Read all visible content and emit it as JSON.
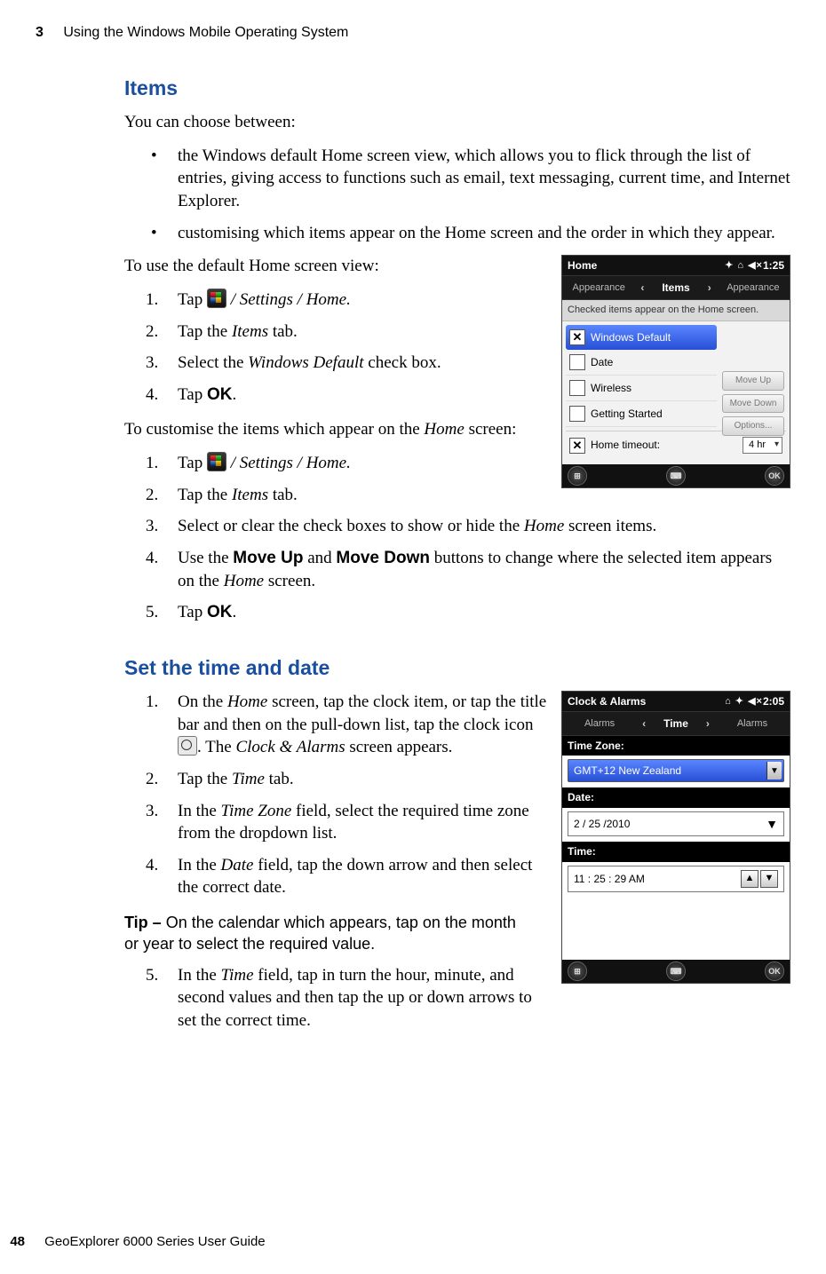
{
  "header": {
    "chapter_number": "3",
    "chapter_title": "Using the Windows Mobile Operating System"
  },
  "section_items": {
    "heading": "Items",
    "intro": "You can choose between:",
    "bullets": [
      "the Windows default Home screen view, which allows you to flick through the list of entries,  giving access to functions such as email, text messaging, current time, and Internet Explorer.",
      "customising which items appear on the Home screen and the order in which they appear."
    ],
    "para_default": "To use the default Home screen view:",
    "steps_default": {
      "s1_pre": "Tap ",
      "s1_post": " / Settings / Home.",
      "s2_pre": "Tap the ",
      "s2_italic": "Items",
      "s2_post": " tab.",
      "s3_pre": "Select the ",
      "s3_italic": "Windows Default",
      "s3_post": " check box.",
      "s4_pre": "Tap ",
      "s4_bold": "OK",
      "s4_post": "."
    },
    "para_custom_pre": "To customise the items which appear on the ",
    "para_custom_italic": "Home",
    "para_custom_post": " screen:",
    "steps_custom": {
      "s1_pre": "Tap ",
      "s1_post": " / Settings / Home.",
      "s2_pre": "Tap the ",
      "s2_italic": "Items",
      "s2_post": " tab.",
      "s3_pre": "Select or clear the check boxes to show or hide the ",
      "s3_italic": "Home",
      "s3_post": " screen items.",
      "s4_pre": "Use the ",
      "s4_b1": "Move Up",
      "s4_mid": " and ",
      "s4_b2": "Move Down",
      "s4_post1": " buttons to change where the selected item appears on the ",
      "s4_italic": "Home",
      "s4_post2": " screen.",
      "s5_pre": "Tap ",
      "s5_bold": "OK",
      "s5_post": "."
    }
  },
  "section_time": {
    "heading": "Set the time and date",
    "s1_a": "On the ",
    "s1_i1": "Home",
    "s1_b": " screen, tap the clock item, or tap the title bar and then on the pull-down list, tap the clock icon ",
    "s1_c": ". The ",
    "s1_i2": "Clock & Alarms",
    "s1_d": " screen appears.",
    "s2_a": "Tap the ",
    "s2_i": "Time",
    "s2_b": " tab.",
    "s3_a": "In the ",
    "s3_i": "Time Zone",
    "s3_b": " field, select the required time zone from the dropdown list.",
    "s4_a": "In the ",
    "s4_i": "Date",
    "s4_b": " field, tap the down arrow and then select the correct date.",
    "tip_label": "Tip – ",
    "tip_text": "On the calendar which appears, tap on the month or year to select the required value.",
    "s5_a": "In the ",
    "s5_i": "Time",
    "s5_b": " field, tap in turn the hour, minute, and second values and then tap the up or down arrows to set the correct time."
  },
  "shot1": {
    "title": "Home",
    "clock": "1:25",
    "tab_left": "Appearance",
    "tab_mid": "Items",
    "tab_right": "Appearance",
    "hint": "Checked items appear on the Home screen.",
    "items": [
      {
        "label": "Windows Default",
        "checked": true,
        "selected": true
      },
      {
        "label": "Date",
        "checked": false,
        "selected": false
      },
      {
        "label": "Wireless",
        "checked": false,
        "selected": false
      },
      {
        "label": "Getting Started",
        "checked": false,
        "selected": false
      }
    ],
    "btns": [
      "Move Up",
      "Move Down",
      "Options..."
    ],
    "timeout_label": "Home timeout:",
    "timeout_value": "4 hr",
    "timeout_checked": true,
    "ok": "OK"
  },
  "shot2": {
    "title": "Clock & Alarms",
    "clock": "2:05",
    "tab_left": "Alarms",
    "tab_mid": "Time",
    "tab_right": "Alarms",
    "tz_label": "Time Zone:",
    "tz_value": "GMT+12 New Zealand",
    "date_label": "Date:",
    "date_value": "2   /  25  /2010",
    "time_label": "Time:",
    "time_value": "11  :  25  :  29     AM",
    "ok": "OK"
  },
  "footer": {
    "page": "48",
    "book": "GeoExplorer 6000 Series User Guide"
  }
}
